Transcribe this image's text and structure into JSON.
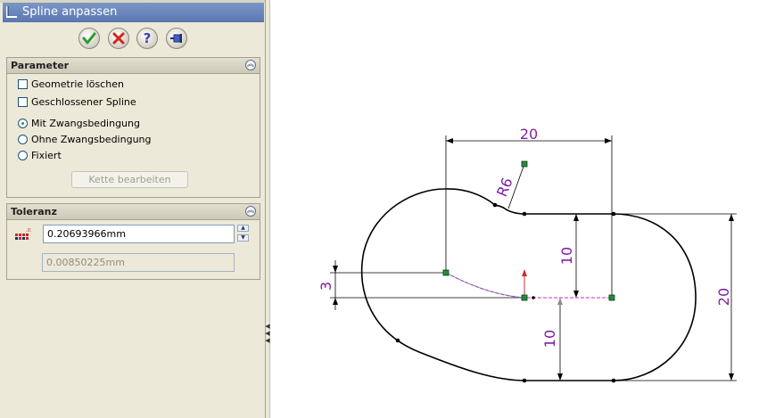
{
  "property_manager": {
    "title": "Spline anpassen",
    "buttons": {
      "ok_icon": "checkmark-icon",
      "cancel_icon": "x-icon",
      "help_icon": "question-icon",
      "pin_icon": "pushpin-icon"
    },
    "parameter_group": {
      "title": "Parameter",
      "checkboxes": [
        {
          "label": "Geometrie löschen",
          "checked": false
        },
        {
          "label": "Geschlossener Spline",
          "checked": false
        }
      ],
      "radios": [
        {
          "label": "Mit Zwangsbedingung",
          "selected": true
        },
        {
          "label": "Ohne Zwangsbedingung",
          "selected": false
        },
        {
          "label": "Fixiert",
          "selected": false
        }
      ],
      "chain_button": "Kette bearbeiten"
    },
    "tolerance_group": {
      "title": "Toleranz",
      "tolerance_value": "0.20693966mm",
      "deviation_value": "0.00850225mm"
    }
  },
  "sketch": {
    "dimensions": {
      "top_width": "20",
      "radius": "R6",
      "inner_height": "10",
      "right_height": "20",
      "left_offset": "3",
      "bottom_height": "10"
    },
    "colors": {
      "dimension": "#7f1fa3",
      "geometry": "#000000",
      "point": "#1f8f3a",
      "spline": "#d25ad2"
    }
  }
}
